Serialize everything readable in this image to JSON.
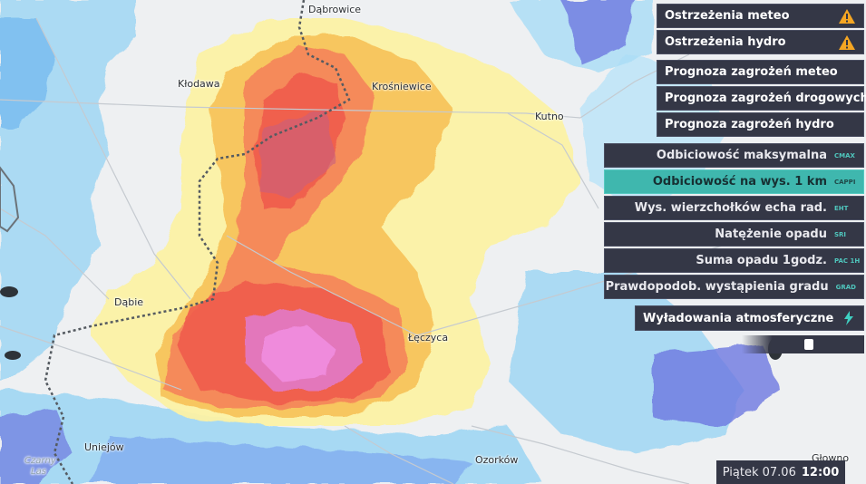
{
  "map": {
    "place_labels": [
      {
        "id": "dabrowice",
        "text": "Dąbrowice"
      },
      {
        "id": "klodawa",
        "text": "Kłodawa"
      },
      {
        "id": "krosniewice",
        "text": "Krośniewice"
      },
      {
        "id": "kutno",
        "text": "Kutno"
      },
      {
        "id": "dabie",
        "text": "Dąbie"
      },
      {
        "id": "leczyca",
        "text": "Łęczyca"
      },
      {
        "id": "uniejow",
        "text": "Uniejów"
      },
      {
        "id": "ozorkow",
        "text": "Ozorków"
      },
      {
        "id": "glowno",
        "text": "Głowno"
      },
      {
        "id": "czarny-las-1",
        "text": "Czarny"
      },
      {
        "id": "czarny-las-2",
        "text": "Las"
      }
    ]
  },
  "warnings": {
    "meteo_label": "Ostrzeżenia meteo",
    "hydro_label": "Ostrzeżenia hydro",
    "warning_icon": "warning-triangle-icon",
    "icon_color": "#f5a623"
  },
  "forecasts": [
    "Prognoza zagrożeń meteo",
    "Prognoza zagrożeń drogowych",
    "Prognoza zagrożeń hydro"
  ],
  "radar_products": [
    {
      "label": "Odbiciowość maksymalna",
      "code": "CMAX",
      "active": false
    },
    {
      "label": "Odbiciowość na wys. 1 km",
      "code": "CAPPI",
      "active": true
    },
    {
      "label": "Wys. wierzchołków echa rad.",
      "code": "EHT",
      "active": false
    },
    {
      "label": "Natężenie opadu",
      "code": "SRI",
      "active": false
    },
    {
      "label": "Suma opadu 1godz.",
      "code": "PAC 1H",
      "active": false
    },
    {
      "label": "Prawdopodob. wystąpienia gradu",
      "code": "GRAD",
      "active": false
    }
  ],
  "lightning": {
    "label": "Wyładowania atmosferyczne",
    "icon": "lightning-bolt-icon",
    "icon_color": "#3fd1c2"
  },
  "timeline": {
    "day_date": "Piątek 07.06",
    "time": "12:00"
  },
  "colors": {
    "panel_bg": "#343746",
    "active_accent": "#3fb7ae"
  }
}
